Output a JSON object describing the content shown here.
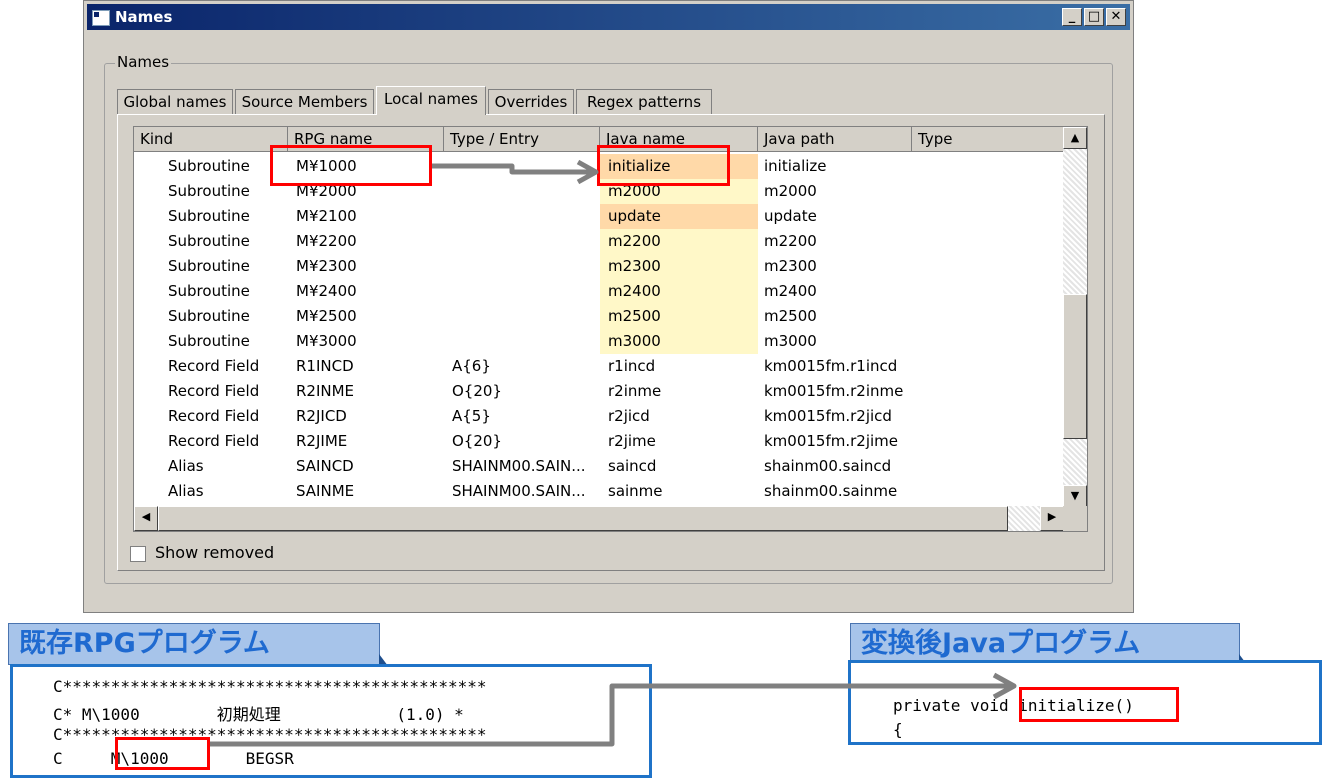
{
  "window": {
    "title": "Names",
    "buttons": [
      "_",
      "□",
      "✕"
    ],
    "group_label": "Names",
    "tabs": [
      "Global names",
      "Source Members",
      "Local names",
      "Overrides",
      "Regex patterns"
    ],
    "active_tab": "Local names",
    "columns": [
      "Kind",
      "RPG name",
      "Type / Entry",
      "Java name",
      "Java path",
      "Type"
    ],
    "rows": [
      {
        "kind": "Subroutine",
        "rpg": "M¥1000",
        "type": "",
        "java": "initialize",
        "path": "initialize"
      },
      {
        "kind": "Subroutine",
        "rpg": "M¥2000",
        "type": "",
        "java": "m2000",
        "path": "m2000"
      },
      {
        "kind": "Subroutine",
        "rpg": "M¥2100",
        "type": "",
        "java": "update",
        "path": "update"
      },
      {
        "kind": "Subroutine",
        "rpg": "M¥2200",
        "type": "",
        "java": "m2200",
        "path": "m2200"
      },
      {
        "kind": "Subroutine",
        "rpg": "M¥2300",
        "type": "",
        "java": "m2300",
        "path": "m2300"
      },
      {
        "kind": "Subroutine",
        "rpg": "M¥2400",
        "type": "",
        "java": "m2400",
        "path": "m2400"
      },
      {
        "kind": "Subroutine",
        "rpg": "M¥2500",
        "type": "",
        "java": "m2500",
        "path": "m2500"
      },
      {
        "kind": "Subroutine",
        "rpg": "M¥3000",
        "type": "",
        "java": "m3000",
        "path": "m3000"
      },
      {
        "kind": "Record Field",
        "rpg": "R1INCD",
        "type": "A{6}",
        "java": "r1incd",
        "path": "km0015fm.r1incd"
      },
      {
        "kind": "Record Field",
        "rpg": "R2INME",
        "type": "O{20}",
        "java": "r2inme",
        "path": "km0015fm.r2inme"
      },
      {
        "kind": "Record Field",
        "rpg": "R2JICD",
        "type": "A{5}",
        "java": "r2jicd",
        "path": "km0015fm.r2jicd"
      },
      {
        "kind": "Record Field",
        "rpg": "R2JIME",
        "type": "O{20}",
        "java": "r2jime",
        "path": "km0015fm.r2jime"
      },
      {
        "kind": "Alias",
        "rpg": "SAINCD",
        "type": "SHAINM00.SAIN...",
        "java": "saincd",
        "path": "shainm00.saincd"
      },
      {
        "kind": "Alias",
        "rpg": "SAINME",
        "type": "SHAINM00.SAIN...",
        "java": "sainme",
        "path": "shainm00.sainme"
      }
    ],
    "show_removed_label": "Show removed"
  },
  "rpg_caption": "既存RPGプログラム",
  "java_caption": "変換後Javaプログラム",
  "rpg_code": [
    "C********************************************",
    "C* M\\1000        初期処理            (1.0) *",
    "C********************************************",
    "C     M\\1000        BEGSR"
  ],
  "java_code": [
    "private void initialize()",
    "{"
  ],
  "colors": {
    "highlight_yellow": "#fff8c8",
    "highlight_orange": "#ffd9a8",
    "red": "#ff0000",
    "blue": "#1f73c8"
  }
}
